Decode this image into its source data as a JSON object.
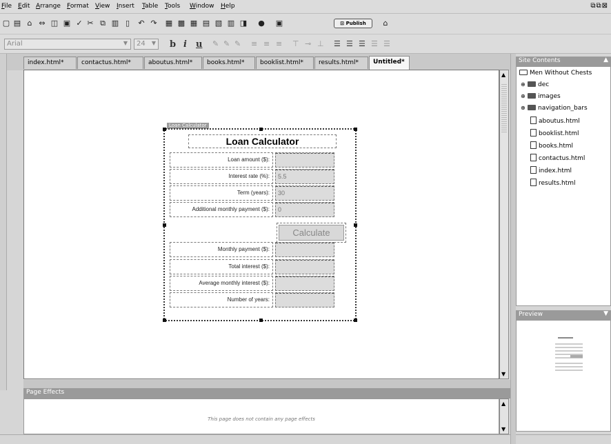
{
  "menu": [
    "File",
    "Edit",
    "Arrange",
    "Format",
    "View",
    "Insert",
    "Table",
    "Tools",
    "Window",
    "Help"
  ],
  "toolbar": {
    "publish_label": "Publish"
  },
  "format_bar": {
    "font": "Arial",
    "size": "24"
  },
  "tabs": [
    "index.html*",
    "contactus.html*",
    "aboutus.html*",
    "books.html*",
    "booklist.html*",
    "results.html*",
    "Untitled*"
  ],
  "calculator": {
    "layer_label": "Loan Calculator",
    "title": "Loan Calculator",
    "inputs": [
      {
        "label": "Loan amount ($):",
        "value": ""
      },
      {
        "label": "Interest rate (%):",
        "value": "5.5"
      },
      {
        "label": "Term (years):",
        "value": "30"
      },
      {
        "label": "Additional monthly payment ($):",
        "value": "0"
      }
    ],
    "button": "Calculate",
    "outputs": [
      {
        "label": "Monthly payment ($):",
        "value": ""
      },
      {
        "label": "Total interest ($):",
        "value": ""
      },
      {
        "label": "Average monthly interest ($):",
        "value": ""
      },
      {
        "label": "Number of years:",
        "value": ""
      }
    ]
  },
  "page_effects": {
    "title": "Page Effects",
    "message": "This page does not contain any page effects"
  },
  "site_contents": {
    "title": "Site Contents",
    "root": "Men Without Chests",
    "folders": [
      "dec",
      "images",
      "navigation_bars"
    ],
    "files": [
      "aboutus.html",
      "booklist.html",
      "books.html",
      "contactus.html",
      "index.html",
      "results.html"
    ]
  },
  "preview": {
    "title": "Preview"
  }
}
